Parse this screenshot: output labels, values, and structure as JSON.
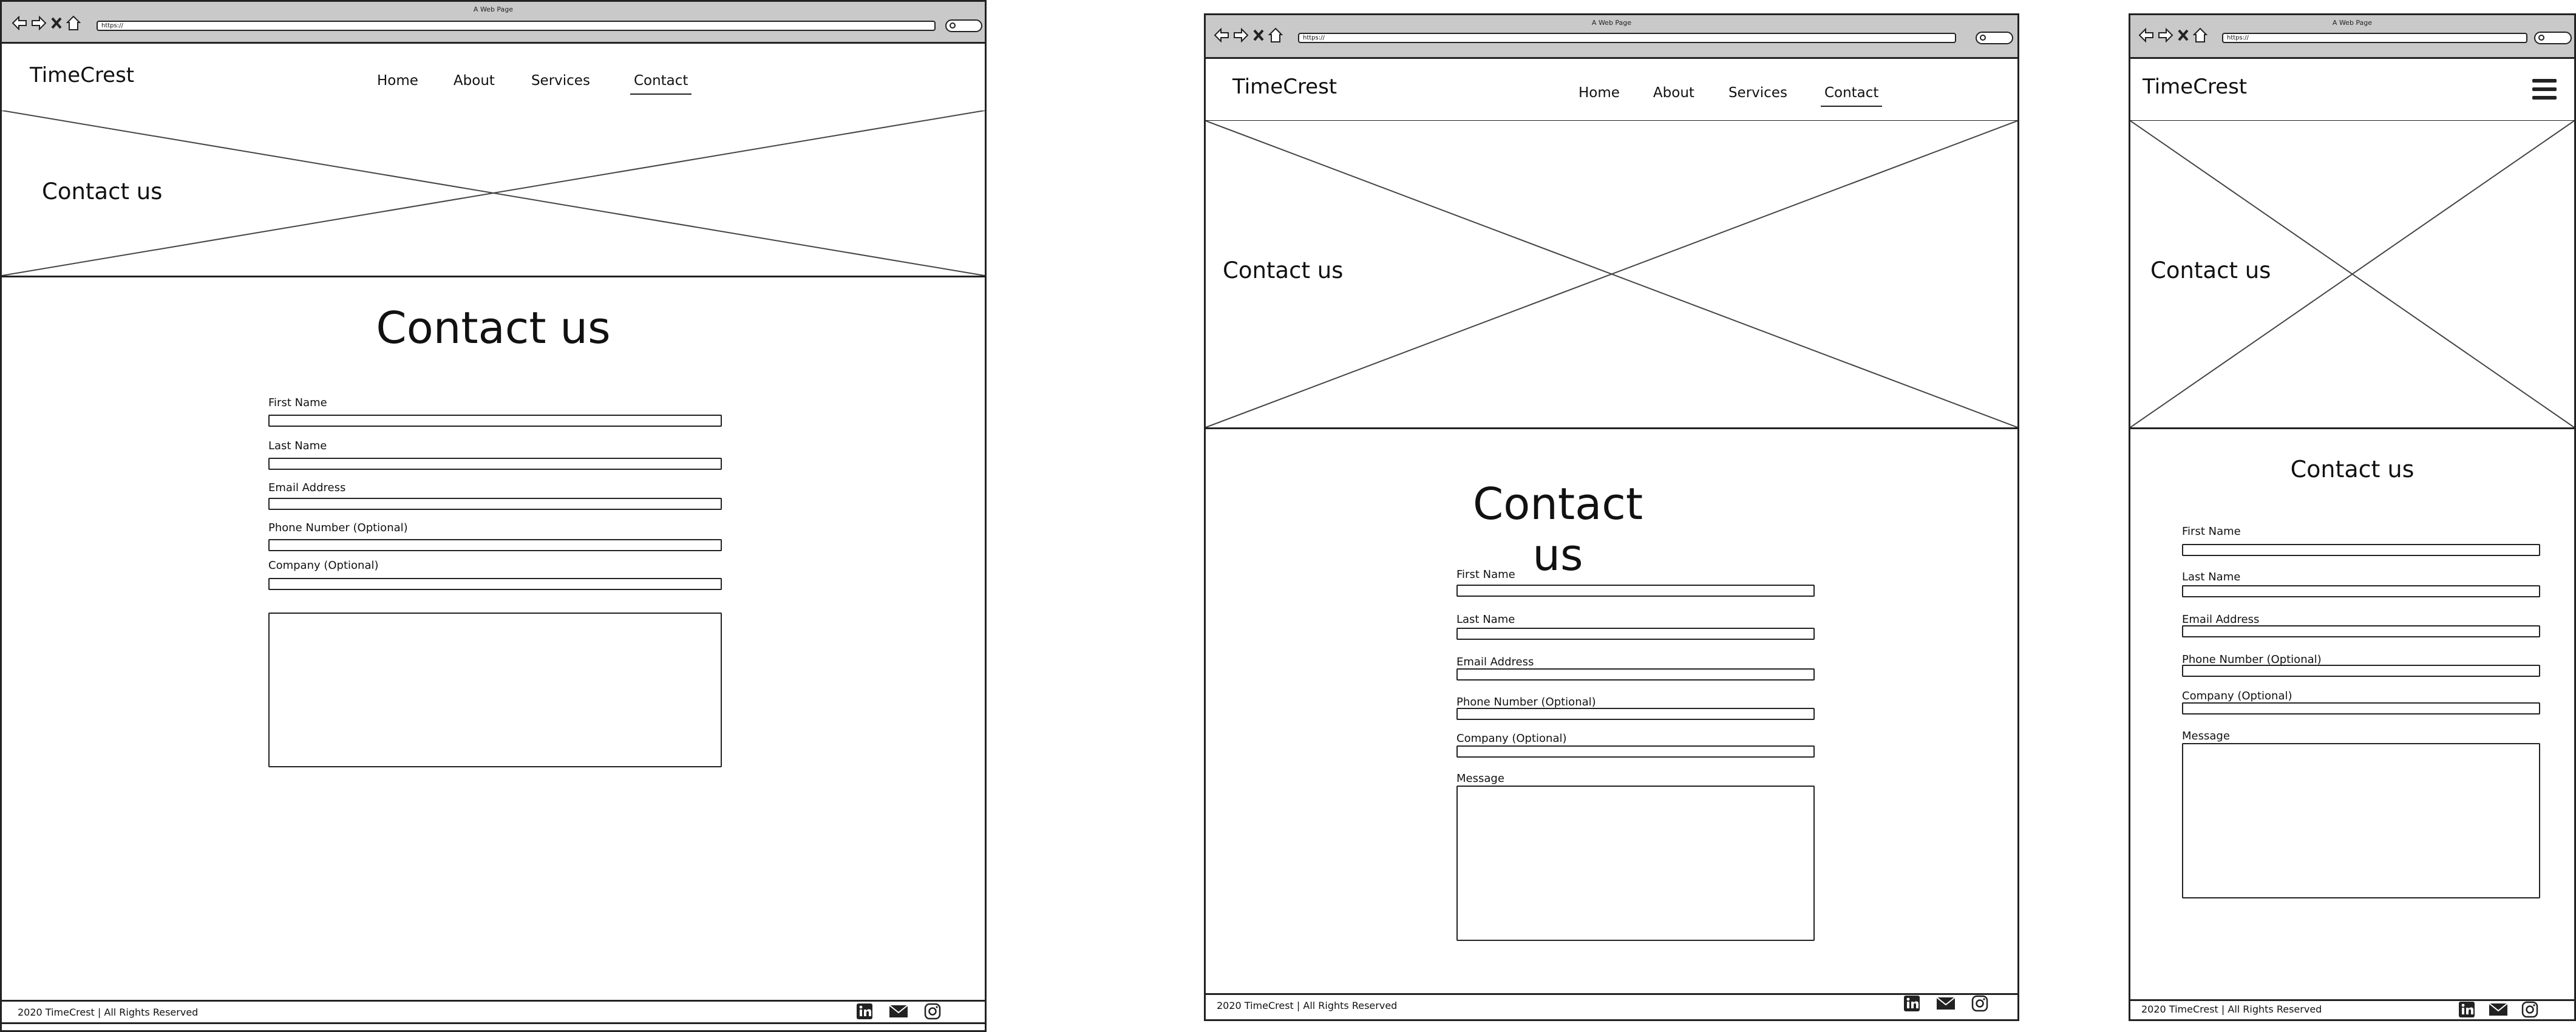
{
  "browser": {
    "title": "A Web Page",
    "url": "https://"
  },
  "site": {
    "logo": "TimeCrest",
    "nav": [
      "Home",
      "About",
      "Services",
      "Contact"
    ],
    "hero_text": "Contact us",
    "page_title": "Contact us",
    "footer_text": "2020 TimeCrest  | All Rights Reserved",
    "social": [
      "linkedin-icon",
      "envelope-icon",
      "instagram-icon"
    ]
  },
  "form": {
    "first_name": "First Name",
    "last_name": "Last Name",
    "email": "Email Address",
    "phone": "Phone Number (Optional)",
    "company": "Company (Optional)",
    "message": "Message"
  }
}
